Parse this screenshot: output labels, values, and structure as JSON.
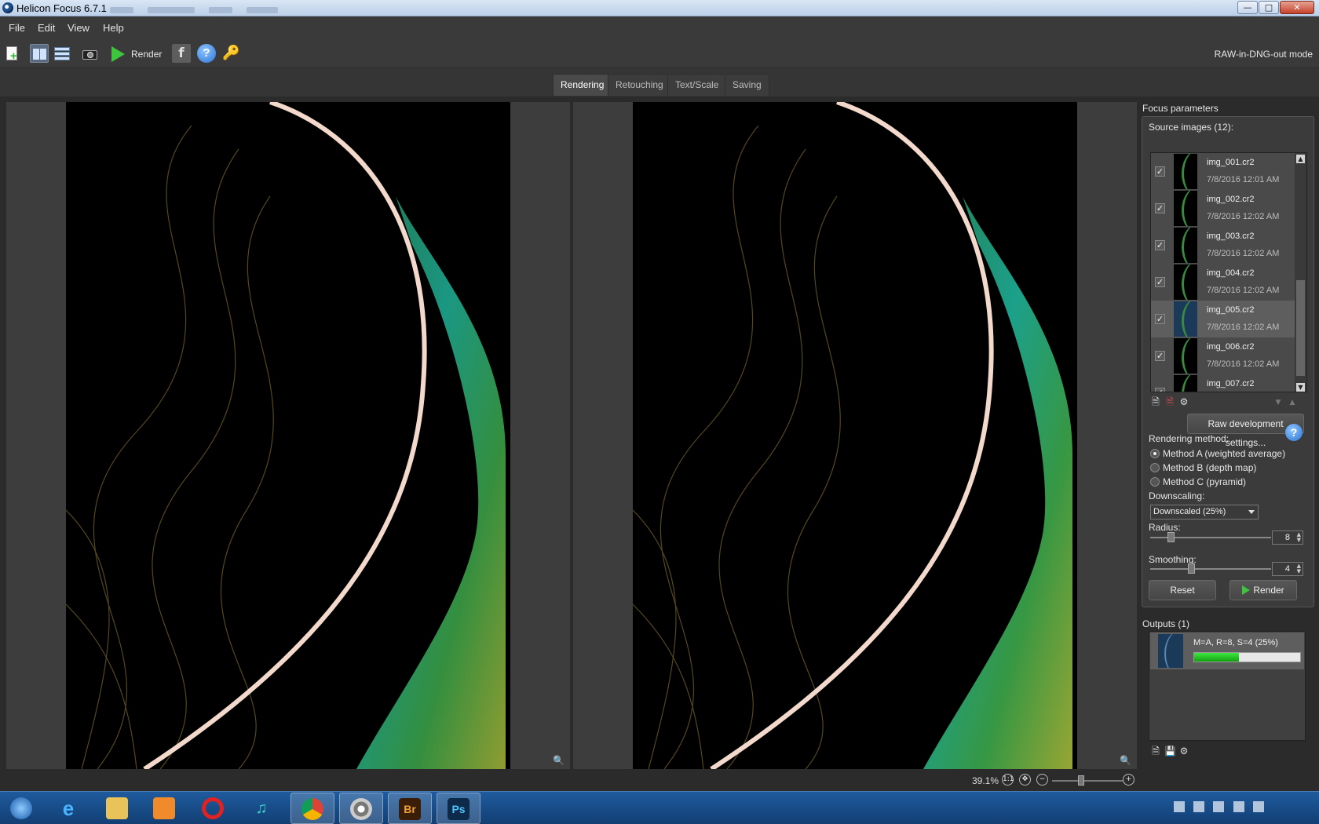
{
  "window": {
    "title": "Helicon Focus 6.7.1 -"
  },
  "menu": {
    "items": [
      "File",
      "Edit",
      "View",
      "Help"
    ]
  },
  "toolbar": {
    "render_label": "Render",
    "mode_label": "RAW-in-DNG-out mode",
    "facebook_glyph": "f",
    "help_glyph": "?"
  },
  "tabs": [
    {
      "label": "Rendering",
      "active": true
    },
    {
      "label": "Retouching",
      "active": false
    },
    {
      "label": "Text/Scale",
      "active": false
    },
    {
      "label": "Saving",
      "active": false
    }
  ],
  "status": {
    "zoom": "39.1%"
  },
  "panel": {
    "title": "Focus parameters",
    "source_title": "Source images (12):",
    "sources": [
      {
        "name": "img_001.cr2",
        "date": "7/8/2016 12:01 AM",
        "checked": true,
        "selected": false
      },
      {
        "name": "img_002.cr2",
        "date": "7/8/2016 12:02 AM",
        "checked": true,
        "selected": false
      },
      {
        "name": "img_003.cr2",
        "date": "7/8/2016 12:02 AM",
        "checked": true,
        "selected": false
      },
      {
        "name": "img_004.cr2",
        "date": "7/8/2016 12:02 AM",
        "checked": true,
        "selected": false
      },
      {
        "name": "img_005.cr2",
        "date": "7/8/2016 12:02 AM",
        "checked": true,
        "selected": true
      },
      {
        "name": "img_006.cr2",
        "date": "7/8/2016 12:02 AM",
        "checked": true,
        "selected": false
      },
      {
        "name": "img_007.cr2",
        "date": "",
        "checked": true,
        "selected": false
      }
    ],
    "raw_button": "Raw development settings...",
    "rendering_method_label": "Rendering method:",
    "methods": [
      {
        "label": "Method A (weighted average)",
        "selected": true
      },
      {
        "label": "Method B (depth map)",
        "selected": false
      },
      {
        "label": "Method C (pyramid)",
        "selected": false
      }
    ],
    "downscaling_label": "Downscaling:",
    "downscaling_value": "Downscaled (25%)",
    "radius_label": "Radius:",
    "radius_value": "8",
    "smoothing_label": "Smoothing:",
    "smoothing_value": "4",
    "reset_button": "Reset",
    "render_button": "Render",
    "outputs_title": "Outputs (1)",
    "output": {
      "label": "M=A, R=8, S=4 (25%)",
      "progress": 0.42
    }
  },
  "colors": {
    "progress_fill": "#2ecc2e",
    "render_green": "#3ec43e",
    "help_blue": "#2b73d4"
  }
}
